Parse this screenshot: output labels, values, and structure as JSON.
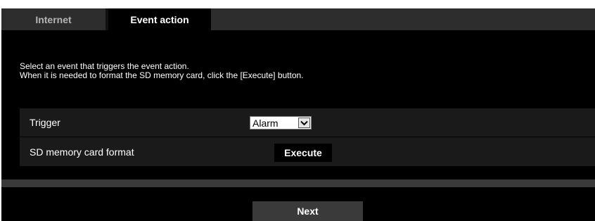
{
  "tabs": [
    {
      "label": "Internet",
      "active": false
    },
    {
      "label": "Event action",
      "active": true
    }
  ],
  "intro": {
    "line1": "Select an event that triggers the event action.",
    "line2": "When it is needed to format the SD memory card, click the [Execute] button."
  },
  "settings": {
    "trigger": {
      "label": "Trigger",
      "value": "Alarm"
    },
    "sd_format": {
      "label": "SD memory card format",
      "button_label": "Execute"
    }
  },
  "footer": {
    "next_label": "Next"
  },
  "colors": {
    "background": "#000000",
    "tabbar": "#2d2d2d",
    "panel": "#1a1a1a",
    "button_gray": "#3a3a3a"
  },
  "icons": {
    "dropdown": "chevron-down-icon"
  }
}
